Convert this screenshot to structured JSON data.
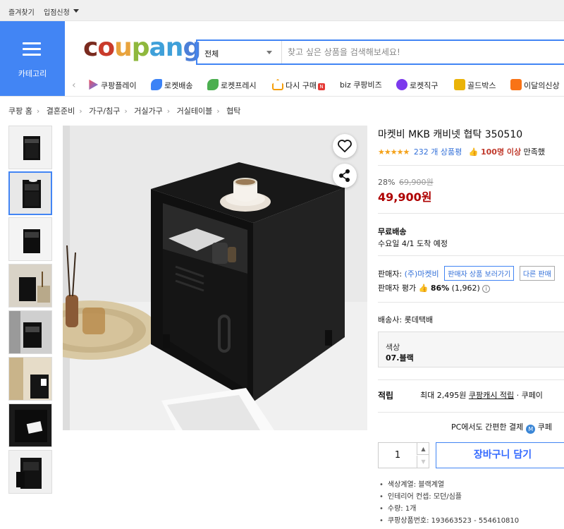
{
  "topbar": {
    "favorites": "즐겨찾기",
    "seller_apply": "입점신청"
  },
  "header": {
    "category_label": "카테고리",
    "logo": [
      "c",
      "o",
      "u",
      "p",
      "a",
      "n",
      "g"
    ],
    "search_category": "전체",
    "search_placeholder": "찾고 싶은 상품을 검색해보세요!"
  },
  "quick_links": [
    "쿠팡플레이",
    "로켓배송",
    "로켓프레시",
    "다시 구매",
    "biz 쿠팡비즈",
    "로켓직구",
    "골드박스",
    "이달의신상"
  ],
  "breadcrumb": [
    "쿠팡 홈",
    "결혼준비",
    "가구/침구",
    "거실가구",
    "거실테이블",
    "협탁"
  ],
  "product": {
    "title": "마켓비 MKB 캐비넷 협탁 350510",
    "stars": "★★★★★",
    "review_count": "232 개 상품평",
    "satisfaction_count": "100명 이상",
    "satisfaction_suffix": "만족했",
    "discount_rate": "28%",
    "original_price": "69,900원",
    "price": "49,900원",
    "shipping_label": "무료배송",
    "delivery_eta": "수요일 4/1 도착 예정",
    "seller_label": "판매자:",
    "seller_name": "(주)마켓비",
    "seller_btn": "판매자 상품 보러가기",
    "seller_btn2": "다른 판매",
    "seller_rating_label": "판매자 평가",
    "seller_rating_pct": "86%",
    "seller_rating_count": "(1,962)",
    "carrier_label": "배송사:",
    "carrier": "롯데택배",
    "option_label": "색상",
    "option_value": "07.블랙",
    "reward_label": "적립",
    "reward_amount": "최대 2,495원",
    "reward_link": "쿠팡캐시 적립",
    "reward_more": "· 쿠페이",
    "pc_pay": "PC에서도 간편한 결제",
    "pc_pay_brand": "쿠페",
    "quantity": "1",
    "cart_button": "장바구니 담기",
    "bullets": [
      "색상계열: 블랙계열",
      "인테리어 컨셉: 모던/심플",
      "수량: 1개",
      "쿠팡상품번호: 193663523 - 554610810"
    ]
  },
  "colors": {
    "accent": "#4285f4",
    "price_red": "#ae0000",
    "star": "#f4a21a",
    "link": "#3471d9"
  }
}
